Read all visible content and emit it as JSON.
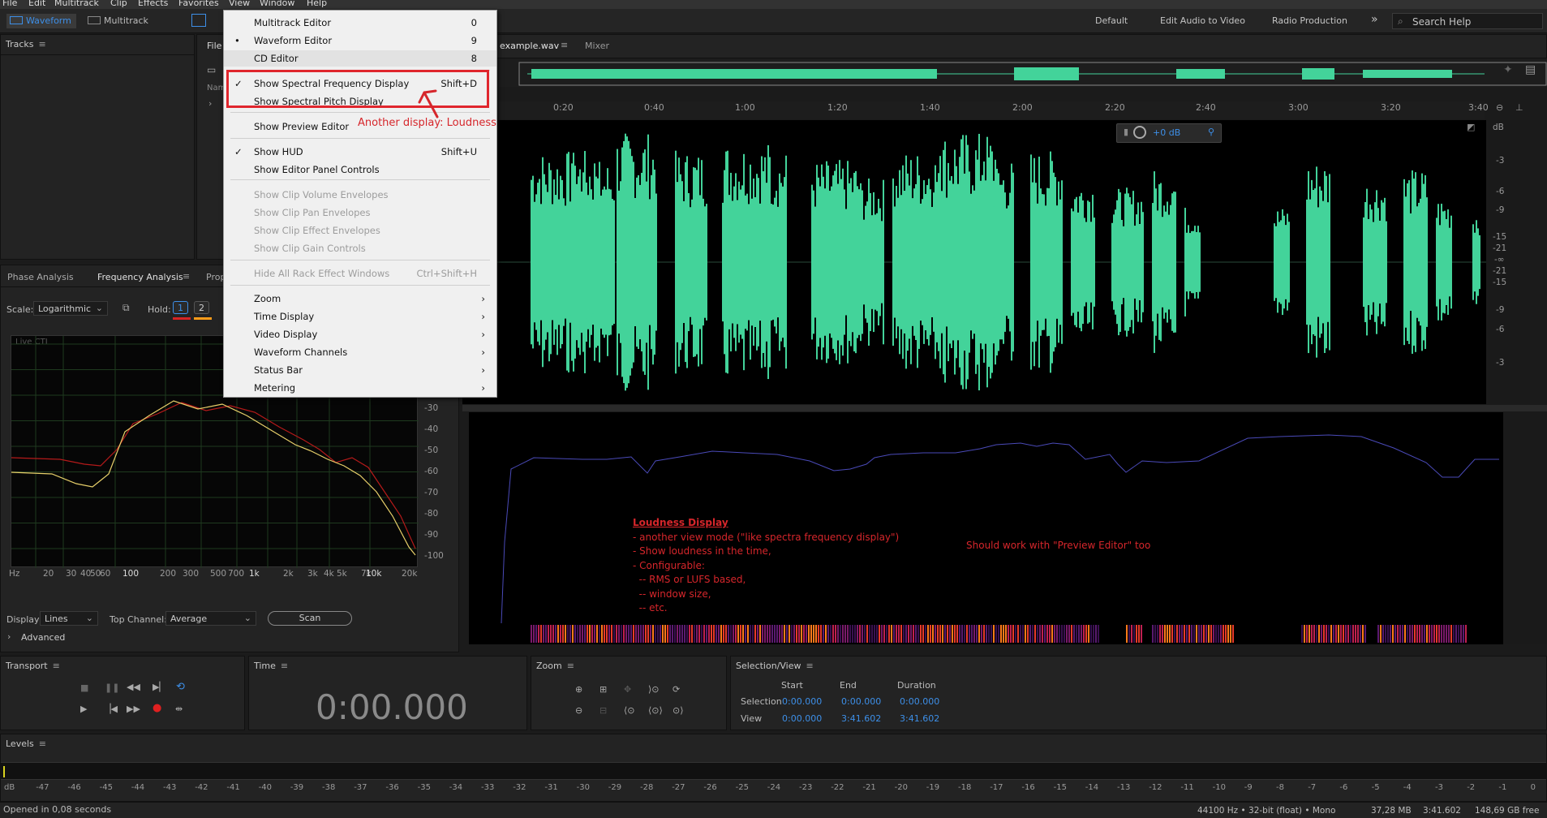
{
  "menubar": [
    "File",
    "Edit",
    "Multitrack",
    "Clip",
    "Effects",
    "Favorites",
    "View",
    "Window",
    "Help"
  ],
  "toolbar": {
    "waveform": "Waveform",
    "multitrack": "Multitrack",
    "workspaces": [
      "Default",
      "Edit Audio to Video",
      "Radio Production"
    ],
    "more": "»",
    "search_placeholder": "Search Help"
  },
  "tracks_panel": {
    "title": "Tracks",
    "files_tab": "File",
    "name_col": "Nam"
  },
  "editor_tabs": {
    "file": "example.wav",
    "mixer": "Mixer"
  },
  "timeline": {
    "ticks": [
      "0:20",
      "0:40",
      "1:00",
      "1:20",
      "1:40",
      "2:00",
      "2:20",
      "2:40",
      "3:00",
      "3:20",
      "3:40"
    ]
  },
  "hud": {
    "gain": "+0 dB"
  },
  "db_scale": {
    "unit": "dB",
    "labels": [
      "-3",
      "-6",
      "-9",
      "-15",
      "-21",
      "-∞",
      "-21",
      "-15",
      "-9",
      "-6",
      "-3"
    ]
  },
  "view_menu": {
    "items": [
      {
        "label": "Multitrack Editor",
        "key": "0",
        "check": ""
      },
      {
        "label": "Waveform Editor",
        "key": "9",
        "check": "•"
      },
      {
        "label": "CD Editor",
        "key": "8",
        "check": ""
      },
      {
        "label": "Show Spectral Frequency Display",
        "key": "Shift+D",
        "check": "✓"
      },
      {
        "label": "Show Spectral Pitch Display",
        "key": "",
        "check": ""
      },
      {
        "label": "Show Preview Editor",
        "key": "",
        "check": ""
      },
      {
        "label": "Show HUD",
        "key": "Shift+U",
        "check": "✓"
      },
      {
        "label": "Show Editor Panel Controls",
        "key": "",
        "check": ""
      },
      {
        "label": "Show Clip Volume Envelopes",
        "key": "",
        "check": ""
      },
      {
        "label": "Show Clip Pan Envelopes",
        "key": "",
        "check": ""
      },
      {
        "label": "Show Clip Effect Envelopes",
        "key": "",
        "check": ""
      },
      {
        "label": "Show Clip Gain Controls",
        "key": "",
        "check": ""
      },
      {
        "label": "Hide All Rack Effect Windows",
        "key": "Ctrl+Shift+H",
        "check": ""
      },
      {
        "label": "Zoom",
        "key": "",
        "check": ""
      },
      {
        "label": "Time Display",
        "key": "",
        "check": ""
      },
      {
        "label": "Video Display",
        "key": "",
        "check": ""
      },
      {
        "label": "Waveform Channels",
        "key": "",
        "check": ""
      },
      {
        "label": "Status Bar",
        "key": "",
        "check": ""
      },
      {
        "label": "Metering",
        "key": "",
        "check": ""
      }
    ]
  },
  "annotations": {
    "loudness_note": "Another display: Loudness",
    "title": "Loudness Display",
    "lines": [
      "- another view mode (\"like spectra frequency display\")",
      "- Show loudness in the time,",
      "- Configurable:",
      "  -- RMS or LUFS based,",
      "  -- window size,",
      "  -- etc."
    ],
    "preview_note": "Should work with \"Preview Editor\" too"
  },
  "analysis": {
    "tabs": [
      "Phase Analysis",
      "Frequency Analysis",
      "Prop"
    ],
    "scale_label": "Scale:",
    "scale_value": "Logarithmic",
    "hold_label": "Hold:",
    "hold": [
      "1",
      "2"
    ],
    "live": "Live CTI",
    "db_ticks": [
      "-30",
      "-40",
      "-50",
      "-60",
      "-70",
      "-80",
      "-90",
      "-100"
    ],
    "hz_ticks": [
      "Hz",
      "20",
      "30",
      "40",
      "50",
      "60",
      "100",
      "200",
      "300",
      "500",
      "700",
      "1k",
      "2k",
      "3k",
      "4k",
      "5k",
      "7k",
      "10k",
      "20k"
    ],
    "display_label": "Display:",
    "display_value": "Lines",
    "top_channel_label": "Top Channel:",
    "top_channel_value": "Average",
    "scan": "Scan",
    "advanced": "Advanced"
  },
  "transport": {
    "title": "Transport"
  },
  "time": {
    "title": "Time",
    "value": "0:00.000"
  },
  "zoom": {
    "title": "Zoom"
  },
  "selection": {
    "title": "Selection/View",
    "cols": [
      "Start",
      "End",
      "Duration"
    ],
    "rows": [
      {
        "label": "Selection",
        "start": "0:00.000",
        "end": "0:00.000",
        "dur": "0:00.000"
      },
      {
        "label": "View",
        "start": "0:00.000",
        "end": "3:41.602",
        "dur": "3:41.602"
      }
    ]
  },
  "levels": {
    "title": "Levels",
    "ticks": [
      "dB",
      "-47",
      "-46",
      "-45",
      "-44",
      "-43",
      "-42",
      "-41",
      "-40",
      "-39",
      "-38",
      "-37",
      "-36",
      "-35",
      "-34",
      "-33",
      "-32",
      "-31",
      "-30",
      "-29",
      "-28",
      "-27",
      "-26",
      "-25",
      "-24",
      "-23",
      "-22",
      "-21",
      "-20",
      "-19",
      "-18",
      "-17",
      "-16",
      "-15",
      "-14",
      "-13",
      "-12",
      "-11",
      "-10",
      "-9",
      "-8",
      "-7",
      "-6",
      "-5",
      "-4",
      "-3",
      "-2",
      "-1",
      "0"
    ]
  },
  "status": {
    "left": "Opened in 0,08 seconds",
    "format": "44100 Hz • 32-bit (float) • Mono",
    "size": "37,28 MB",
    "duration": "3:41.602",
    "free": "148,69 GB free"
  }
}
